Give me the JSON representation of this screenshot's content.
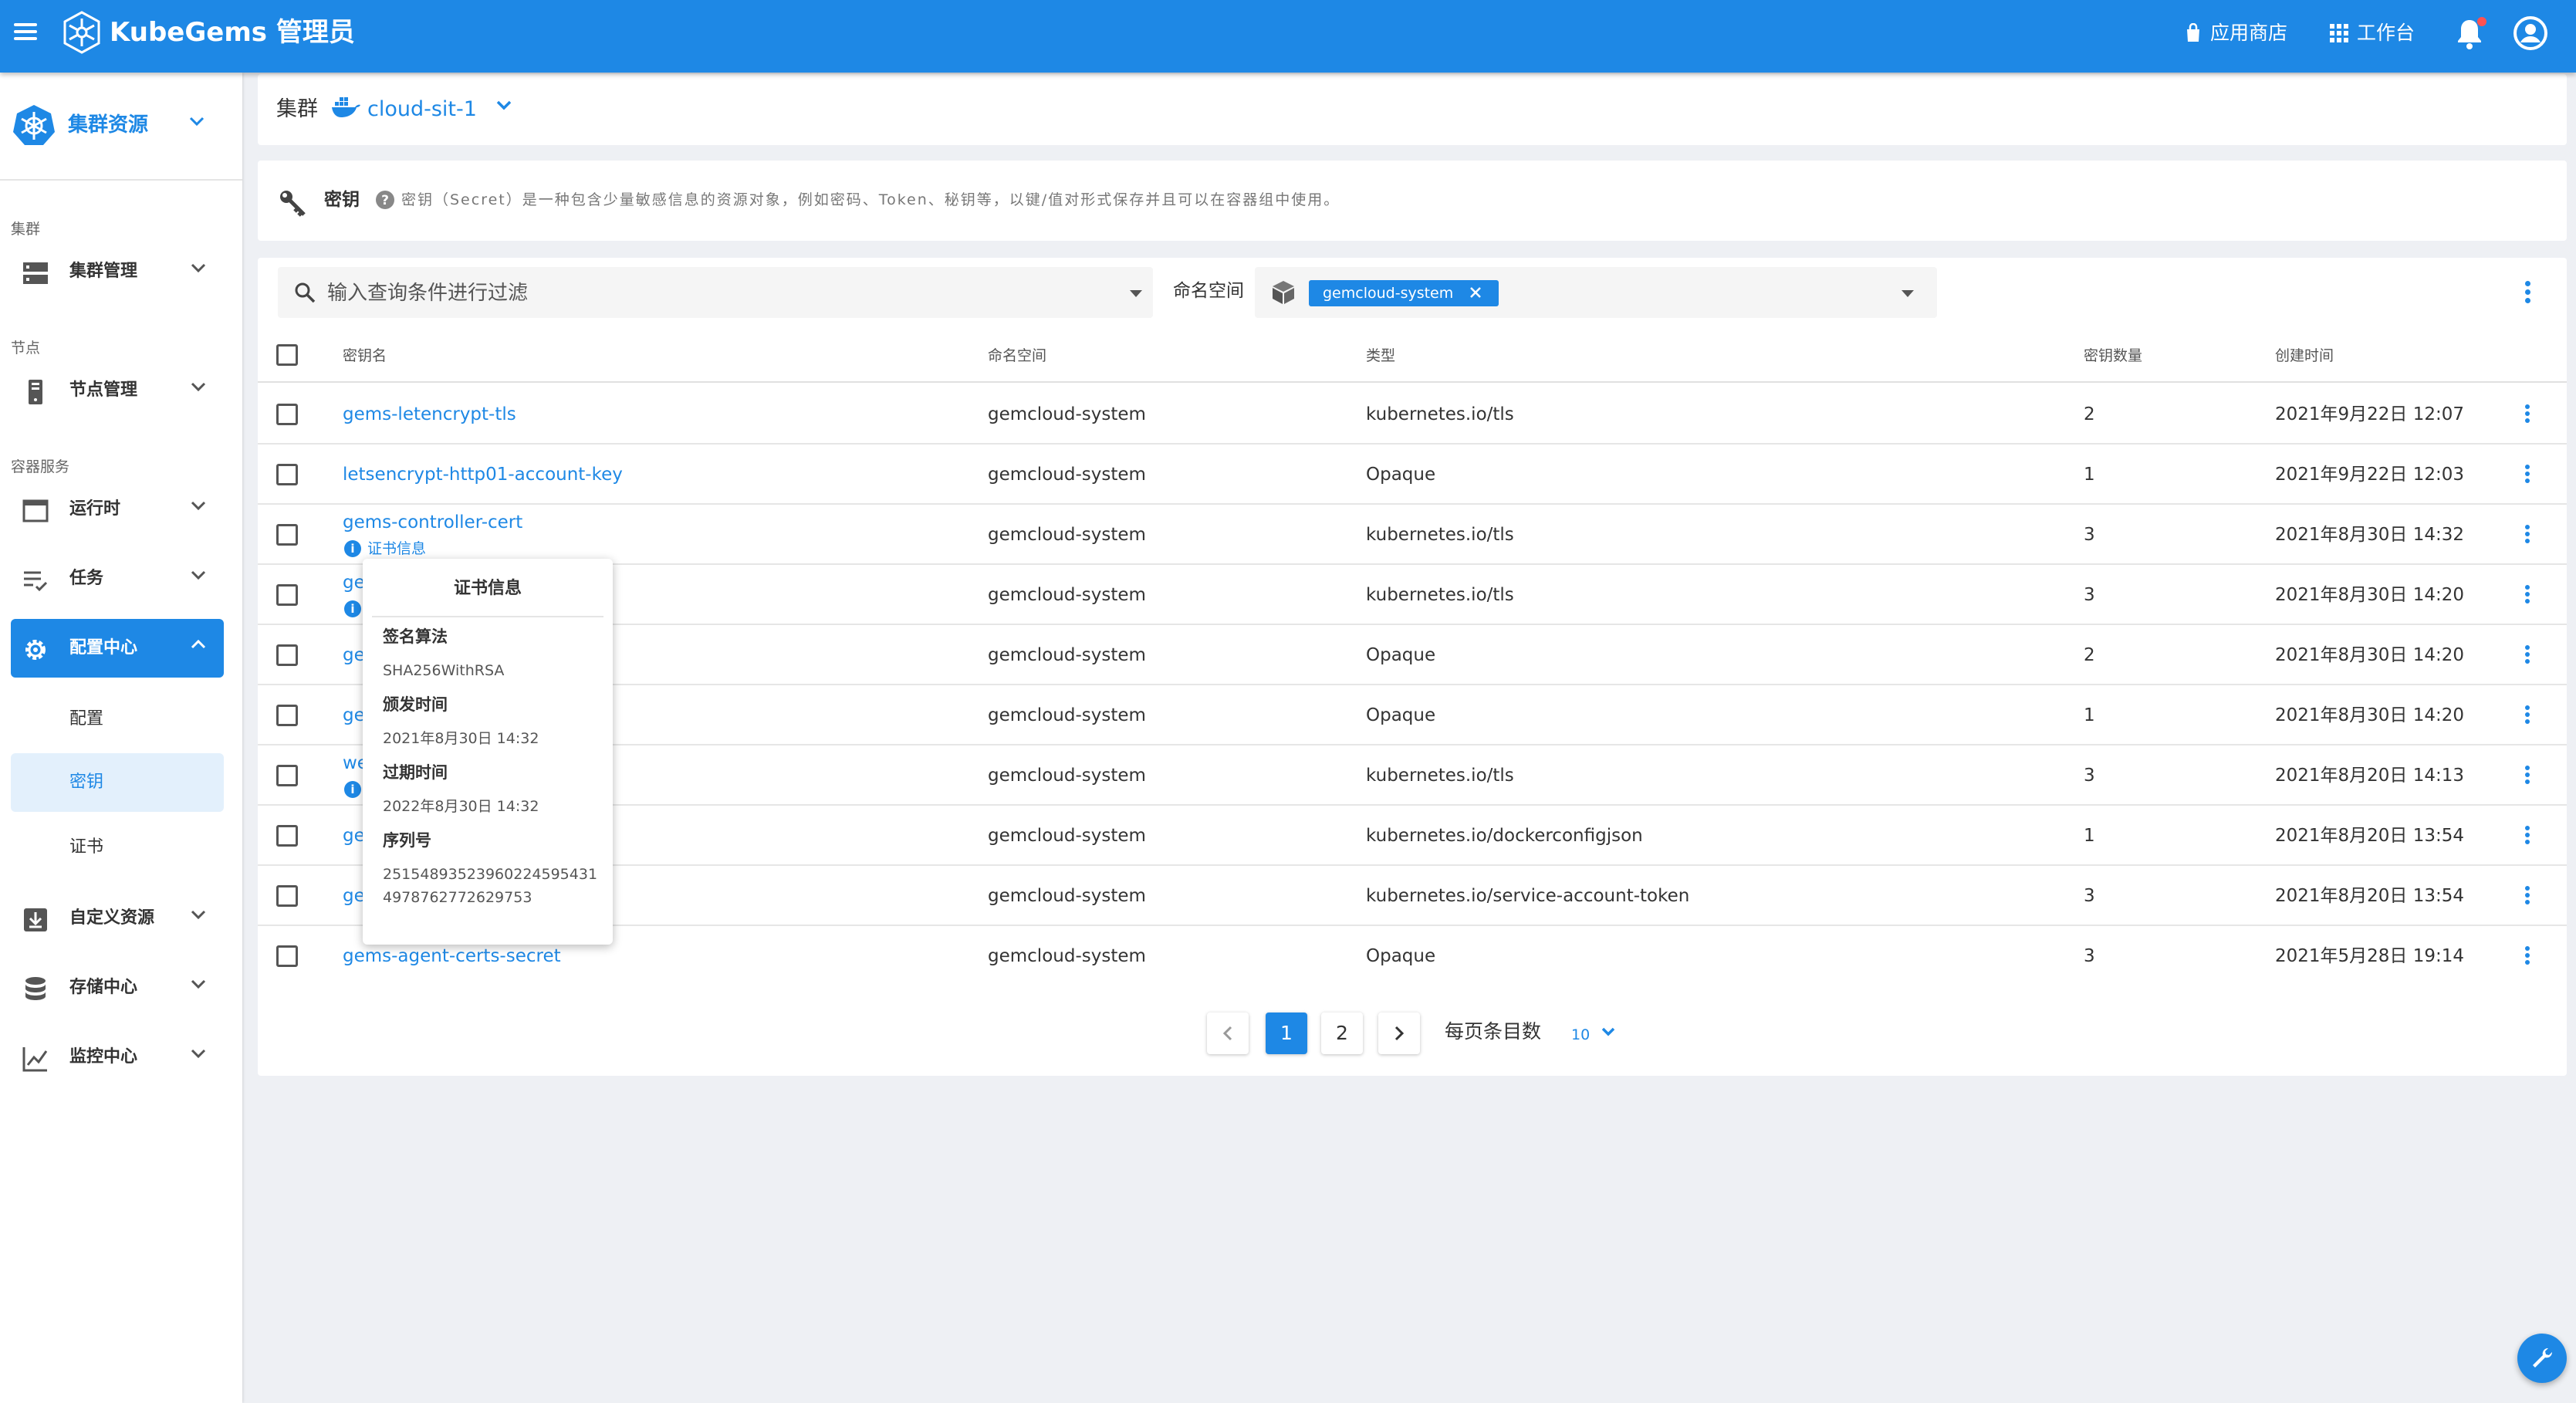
{
  "app": {
    "brand": "KubeGems 管理员",
    "store_label": "应用商店",
    "workbench_label": "工作台"
  },
  "sidebar": {
    "header_title": "集群资源",
    "sections": {
      "cluster": "集群",
      "node": "节点",
      "container": "容器服务"
    },
    "items": {
      "cluster_mgmt": "集群管理",
      "node_mgmt": "节点管理",
      "runtime": "运行时",
      "jobs": "任务",
      "config_center": "配置中心",
      "config": "配置",
      "secret": "密钥",
      "cert": "证书",
      "custom_resource": "自定义资源",
      "storage": "存储中心",
      "monitor": "监控中心"
    }
  },
  "cluster_bar": {
    "label": "集群",
    "name": "cloud-sit-1"
  },
  "info": {
    "title": "密钥",
    "description": "密钥（Secret）是一种包含少量敏感信息的资源对象，例如密码、Token、秘钥等，以键/值对形式保存并且可以在容器组中使用。"
  },
  "filter": {
    "placeholder": "输入查询条件进行过滤",
    "namespace_label": "命名空间",
    "namespace_chip": "gemcloud-system"
  },
  "table": {
    "headers": {
      "name": "密钥名",
      "namespace": "命名空间",
      "type": "类型",
      "count": "密钥数量",
      "created": "创建时间"
    },
    "cert_link": "证书信息",
    "rows": [
      {
        "name": "gems-letencrypt-tls",
        "namespace": "gemcloud-system",
        "type": "kubernetes.io/tls",
        "count": "2",
        "created": "2021年9月22日 12:07"
      },
      {
        "name": "letsencrypt-http01-account-key",
        "namespace": "gemcloud-system",
        "type": "Opaque",
        "count": "1",
        "created": "2021年9月22日 12:03"
      },
      {
        "name": "gems-controller-cert",
        "namespace": "gemcloud-system",
        "type": "kubernetes.io/tls",
        "count": "3",
        "created": "2021年8月30日 14:32"
      },
      {
        "name": "ge",
        "namespace": "gemcloud-system",
        "type": "kubernetes.io/tls",
        "count": "3",
        "created": "2021年8月30日 14:20"
      },
      {
        "name": "ge",
        "namespace": "gemcloud-system",
        "type": "Opaque",
        "count": "2",
        "created": "2021年8月30日 14:20"
      },
      {
        "name": "ge",
        "namespace": "gemcloud-system",
        "type": "Opaque",
        "count": "1",
        "created": "2021年8月30日 14:20"
      },
      {
        "name": "we",
        "namespace": "gemcloud-system",
        "type": "kubernetes.io/tls",
        "count": "3",
        "created": "2021年8月20日 14:13"
      },
      {
        "name": "ge",
        "namespace": "gemcloud-system",
        "type": "kubernetes.io/dockerconfigjson",
        "count": "1",
        "created": "2021年8月20日 13:54"
      },
      {
        "name": "ge",
        "namespace": "gemcloud-system",
        "type": "kubernetes.io/service-account-token",
        "count": "3",
        "created": "2021年8月20日 13:54"
      },
      {
        "name": "gems-agent-certs-secret",
        "namespace": "gemcloud-system",
        "type": "Opaque",
        "count": "3",
        "created": "2021年5月28日 19:14"
      }
    ]
  },
  "pagination": {
    "pages": [
      "1",
      "2"
    ],
    "per_page_label": "每页条目数",
    "per_page_value": "10"
  },
  "tooltip": {
    "title": "证书信息",
    "sig_label": "签名算法",
    "sig_value": "SHA256WithRSA",
    "issued_label": "颁发时间",
    "issued_value": "2021年8月30日 14:32",
    "expire_label": "过期时间",
    "expire_value": "2022年8月30日 14:32",
    "serial_label": "序列号",
    "serial_value": "251548935239602245954314978762772629753"
  },
  "colors": {
    "primary": "#1e88e5",
    "badge": "#ff5252"
  }
}
